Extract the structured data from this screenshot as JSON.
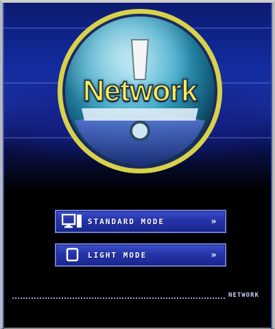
{
  "logo": {
    "text": "Network",
    "icon": "exclamation-globe-icon"
  },
  "modes": [
    {
      "label": "STANDARD MODE",
      "icon": "monitor-icon",
      "arrow": "»"
    },
    {
      "label": "LIGHT MODE",
      "icon": "square-icon",
      "arrow": "»"
    }
  ],
  "footer": {
    "label": "NETWORK"
  },
  "colors": {
    "background": "#000000",
    "accent_blue": "#2534a8",
    "button_border": "#6e7fd9",
    "logo_yellow": "#ffeb55",
    "logo_teal": "#3aa7c7"
  }
}
